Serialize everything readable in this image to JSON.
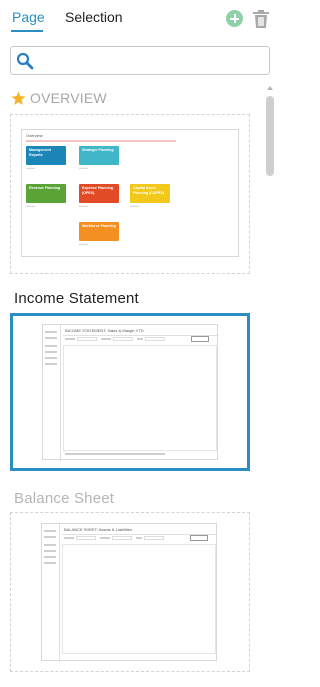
{
  "tabs": [
    {
      "label": "Page",
      "active": true
    },
    {
      "label": "Selection",
      "active": false
    }
  ],
  "search": {
    "value": "",
    "placeholder": ""
  },
  "pages": [
    {
      "title": "OVERVIEW",
      "starred": true,
      "thumbnail": {
        "heading": "Overview",
        "tiles": [
          {
            "label": "Management Reports",
            "color": "#1c86b8"
          },
          {
            "label": "Strategic Planning",
            "color": "#3fb7c9"
          },
          {
            "label": "Revenue Planning",
            "color": "#5aa437"
          },
          {
            "label": "Expense Planning (OPEX)",
            "color": "#e24b26"
          },
          {
            "label": "Capital Asset Planning (CAPEX)",
            "color": "#f2c81a"
          },
          {
            "label": "Workforce Planning",
            "color": "#f39021"
          }
        ]
      }
    },
    {
      "title": "Income Statement",
      "selected": true,
      "thumbnail": {
        "heading": "INCOME STATEMENT: Sales & Margin YTD"
      }
    },
    {
      "title": "Balance Sheet",
      "selected": false,
      "thumbnail": {
        "heading": "BALANCE SHEET: Assets & Liabilities"
      }
    }
  ],
  "colors": {
    "accent": "#2a8ec4",
    "add": "#8fd1a8",
    "star": "#f5b41e"
  }
}
